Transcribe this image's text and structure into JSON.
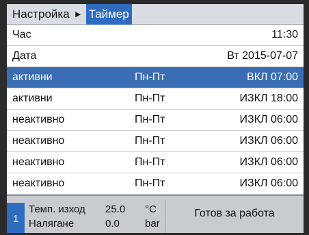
{
  "breadcrumb": {
    "root": "Настройка",
    "separator": "►",
    "current": "Таймер"
  },
  "settings": [
    {
      "label": "Час",
      "value": "11:30"
    },
    {
      "label": "Дата",
      "value": "Вт 2015-07-07"
    }
  ],
  "timers": [
    {
      "status": "активни",
      "days": "Пн-Пт",
      "action": "ВКЛ  07:00",
      "selected": true
    },
    {
      "status": "активни",
      "days": "Пн-Пт",
      "action": "ИЗКЛ  18:00"
    },
    {
      "status": "неактивно",
      "days": "Пн-Пт",
      "action": "ИЗКЛ  06:00"
    },
    {
      "status": "неактивно",
      "days": "Пн-Пт",
      "action": "ИЗКЛ  06:00"
    },
    {
      "status": "неактивно",
      "days": "Пн-Пт",
      "action": "ИЗКЛ  06:00"
    },
    {
      "status": "неактивно",
      "days": "Пн-Пт",
      "action": "ИЗКЛ  06:00"
    }
  ],
  "status_bar": {
    "unit_number": "1",
    "flow_temp_label": "Темп. изход",
    "flow_temp_value": "25.0",
    "flow_temp_unit": "°C",
    "pressure_label": "Налягане",
    "pressure_value": "0.0",
    "pressure_unit": "bar",
    "state_text": "Готов за работа"
  },
  "colors": {
    "accent": "#2e6cc0",
    "selected_row": "#3a6db4",
    "header_bg": "#d9dde3",
    "status_bg": "#c8ccd1"
  }
}
